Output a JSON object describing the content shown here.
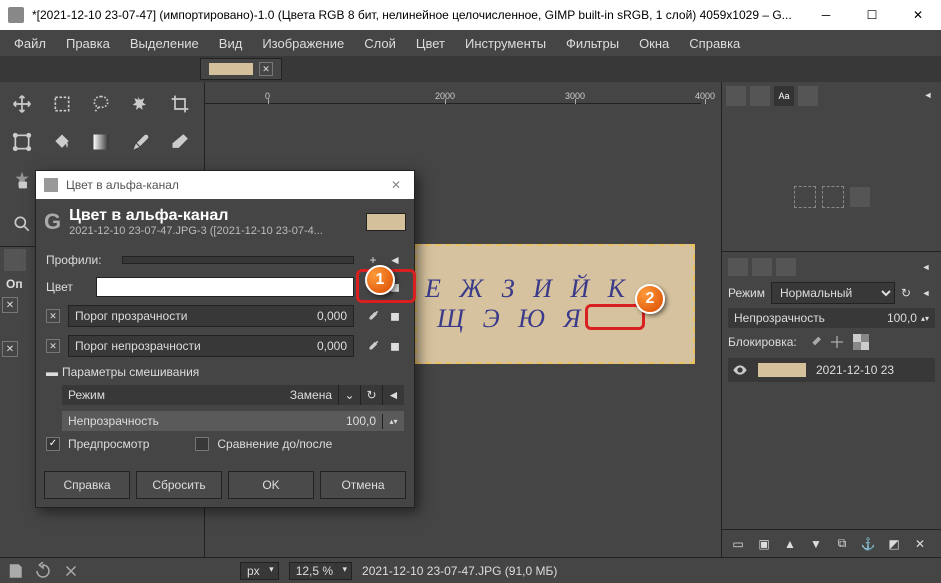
{
  "window": {
    "title": "*[2021-12-10 23-07-47] (импортировано)-1.0 (Цвета RGB 8 бит, нелинейное целочисленное, GIMP built-in sRGB, 1 слой) 4059x1029 – G..."
  },
  "menu": [
    "Файл",
    "Правка",
    "Выделение",
    "Вид",
    "Изображение",
    "Слой",
    "Цвет",
    "Инструменты",
    "Фильтры",
    "Окна",
    "Справка"
  ],
  "ruler_ticks": [
    {
      "pos": 60,
      "label": "0"
    },
    {
      "pos": 230,
      "label": "2000"
    },
    {
      "pos": 360,
      "label": "3000"
    },
    {
      "pos": 490,
      "label": "4000"
    }
  ],
  "left_lower": {
    "title": "Оп"
  },
  "dialog": {
    "title": "Цвет в альфа-канал",
    "header_title": "Цвет в альфа-канал",
    "header_sub": "2021-12-10 23-07-47.JPG-3 ([2021-12-10 23-07-4...",
    "presets_label": "Профили:",
    "color_label": "Цвет",
    "threshold_t_label": "Порог прозрачности",
    "threshold_t_value": "0,000",
    "threshold_o_label": "Порог непрозрачности",
    "threshold_o_value": "0,000",
    "blend_section": "Параметры смешивания",
    "mode_label": "Режим",
    "mode_value": "Замена",
    "opacity_label": "Непрозрачность",
    "opacity_value": "100,0",
    "preview_label": "Предпросмотр",
    "split_label": "Сравнение до/после",
    "buttons": {
      "help": "Справка",
      "reset": "Сбросить",
      "ok": "OK",
      "cancel": "Отмена"
    }
  },
  "canvas_text": {
    "row1": "Е Ж З И Й К",
    "row2": "Щ Э Ю Я"
  },
  "callouts": {
    "one": "1",
    "two": "2"
  },
  "right": {
    "mode_label": "Режим",
    "mode_value": "Нормальный",
    "opacity_label": "Непрозрачность",
    "opacity_value": "100,0",
    "lock_label": "Блокировка:",
    "layer_name": "2021-12-10 23"
  },
  "status": {
    "unit": "px",
    "zoom": "12,5 %",
    "info": "2021-12-10 23-07-47.JPG (91,0 МБ)"
  }
}
